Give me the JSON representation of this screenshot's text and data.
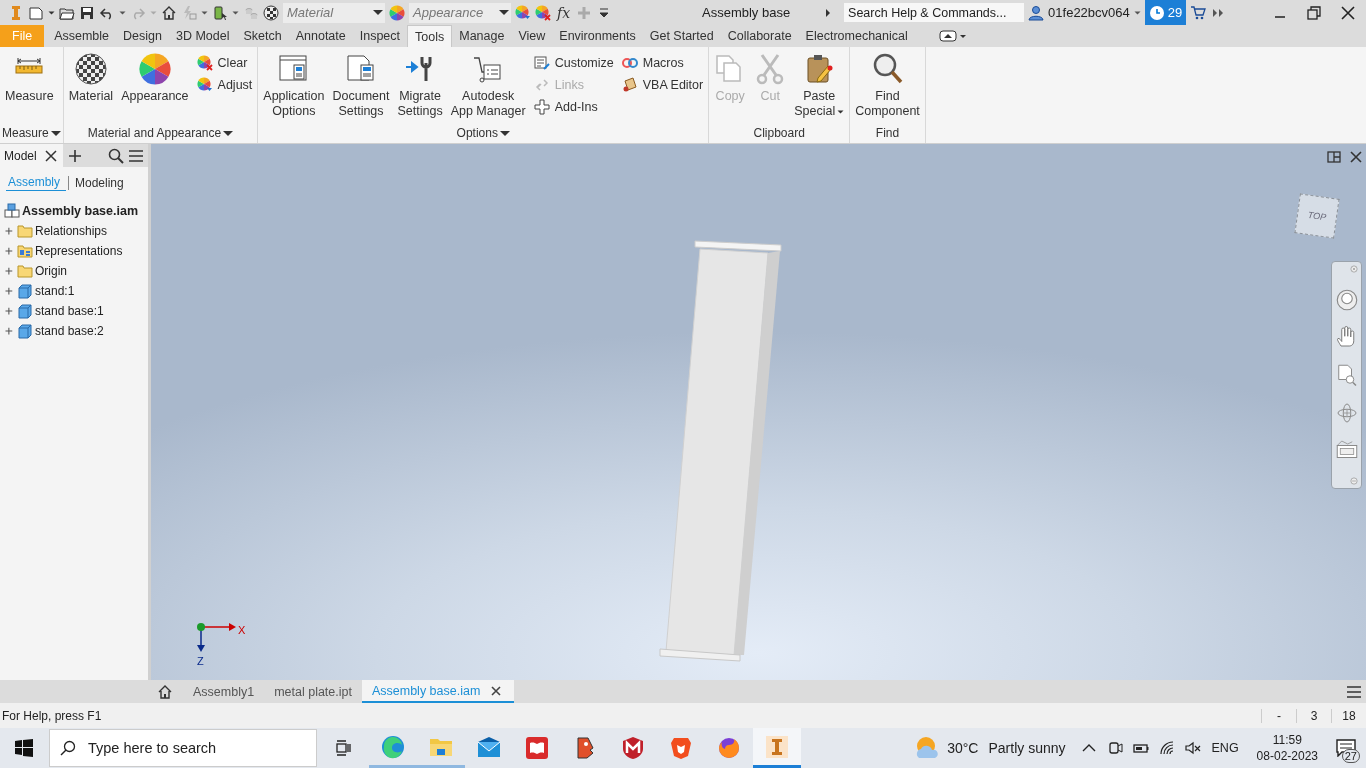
{
  "quick_access": {
    "material_field": {
      "placeholder": "Material"
    },
    "appearance_field": {
      "placeholder": "Appearance"
    },
    "formula_button": "fx"
  },
  "window": {
    "title": "Assembly base"
  },
  "help_search": {
    "placeholder": "Search Help & Commands..."
  },
  "account": {
    "user": "01fe22bcv064",
    "notification_count": "29"
  },
  "ribbon_tabs": [
    {
      "label": "File",
      "kind": "application",
      "selected": false
    },
    {
      "label": "Assemble",
      "kind": "tab",
      "selected": false
    },
    {
      "label": "Design",
      "kind": "tab",
      "selected": false
    },
    {
      "label": "3D Model",
      "kind": "tab",
      "selected": false
    },
    {
      "label": "Sketch",
      "kind": "tab",
      "selected": false
    },
    {
      "label": "Annotate",
      "kind": "tab",
      "selected": false
    },
    {
      "label": "Inspect",
      "kind": "tab",
      "selected": false
    },
    {
      "label": "Tools",
      "kind": "tab",
      "selected": true
    },
    {
      "label": "Manage",
      "kind": "tab",
      "selected": false
    },
    {
      "label": "View",
      "kind": "tab",
      "selected": false
    },
    {
      "label": "Environments",
      "kind": "tab",
      "selected": false
    },
    {
      "label": "Get Started",
      "kind": "tab",
      "selected": false
    },
    {
      "label": "Collaborate",
      "kind": "tab",
      "selected": false
    },
    {
      "label": "Electromechanical",
      "kind": "tab",
      "selected": false
    }
  ],
  "ribbon_panels": [
    {
      "title": "Measure",
      "has_menu": true,
      "tools": [
        {
          "label": "Measure",
          "kind": "large",
          "disabled": false,
          "has_menu": false
        }
      ]
    },
    {
      "title": "Material and Appearance",
      "has_menu": true,
      "tools": [
        {
          "label": "Material",
          "kind": "large",
          "disabled": false,
          "has_menu": false
        },
        {
          "label": "Appearance",
          "kind": "large",
          "disabled": false,
          "has_menu": false
        },
        {
          "label": "Clear",
          "kind": "small",
          "disabled": false,
          "has_menu": false
        },
        {
          "label": "Adjust",
          "kind": "small",
          "disabled": false,
          "has_menu": false
        }
      ]
    },
    {
      "title": "Options",
      "has_menu": true,
      "tools": [
        {
          "label": "Application Options",
          "kind": "large",
          "disabled": false,
          "has_menu": false
        },
        {
          "label": "Document Settings",
          "kind": "large",
          "disabled": false,
          "has_menu": false
        },
        {
          "label": "Migrate Settings",
          "kind": "large",
          "disabled": false,
          "has_menu": false
        },
        {
          "label": "Autodesk App Manager",
          "kind": "large",
          "disabled": false,
          "has_menu": false
        },
        {
          "label": "Customize",
          "kind": "small",
          "disabled": false,
          "has_menu": false
        },
        {
          "label": "Links",
          "kind": "small",
          "disabled": true,
          "has_menu": false
        },
        {
          "label": "Add-Ins",
          "kind": "small",
          "disabled": false,
          "has_menu": false
        },
        {
          "label": "Macros",
          "kind": "small",
          "disabled": false,
          "has_menu": false
        },
        {
          "label": "VBA Editor",
          "kind": "small",
          "disabled": false,
          "has_menu": false
        }
      ]
    },
    {
      "title": "Clipboard",
      "has_menu": false,
      "tools": [
        {
          "label": "Copy",
          "kind": "large",
          "disabled": true,
          "has_menu": false
        },
        {
          "label": "Cut",
          "kind": "large",
          "disabled": true,
          "has_menu": false
        },
        {
          "label": "Paste Special",
          "kind": "large",
          "disabled": false,
          "has_menu": true
        }
      ]
    },
    {
      "title": "Find",
      "has_menu": false,
      "tools": [
        {
          "label": "Find Component",
          "kind": "large",
          "disabled": false,
          "has_menu": false
        }
      ]
    }
  ],
  "model_browser": {
    "tab": "Model",
    "views": [
      {
        "label": "Assembly",
        "selected": true
      },
      {
        "label": "Modeling",
        "selected": false
      }
    ],
    "tree": {
      "label": "Assembly base.iam",
      "children": [
        {
          "label": "Relationships",
          "kind": "folder",
          "expanded": false
        },
        {
          "label": "Representations",
          "kind": "representations",
          "expanded": false
        },
        {
          "label": "Origin",
          "kind": "folder",
          "expanded": false
        },
        {
          "label": "stand:1",
          "kind": "part",
          "expanded": false
        },
        {
          "label": "stand base:1",
          "kind": "part",
          "expanded": false
        },
        {
          "label": "stand base:2",
          "kind": "part",
          "expanded": false
        }
      ]
    }
  },
  "viewport": {
    "view_cube": "TOP",
    "axes": {
      "x": "X",
      "z": "Z"
    }
  },
  "document_tabs": [
    {
      "label": "Assembly1",
      "selected": false
    },
    {
      "label": "metal plate.ipt",
      "selected": false
    },
    {
      "label": "Assembly base.iam",
      "selected": true
    }
  ],
  "status_bar": {
    "message": "For Help, press F1",
    "fields": [
      "-",
      "3",
      "18"
    ]
  },
  "taskbar": {
    "search": {
      "placeholder": "Type here to search"
    },
    "apps": [
      {
        "running": true,
        "selected": false
      },
      {
        "running": true,
        "selected": false
      },
      {
        "running": false,
        "selected": false
      },
      {
        "running": false,
        "selected": false
      },
      {
        "running": false,
        "selected": false
      },
      {
        "running": false,
        "selected": false
      },
      {
        "running": false,
        "selected": false
      },
      {
        "running": false,
        "selected": false
      },
      {
        "running": true,
        "selected": true
      }
    ],
    "weather": {
      "temperature": "30°C",
      "condition": "Partly sunny"
    },
    "language": "ENG",
    "time": "11:59",
    "date": "08-02-2023",
    "notification_count": "27"
  }
}
